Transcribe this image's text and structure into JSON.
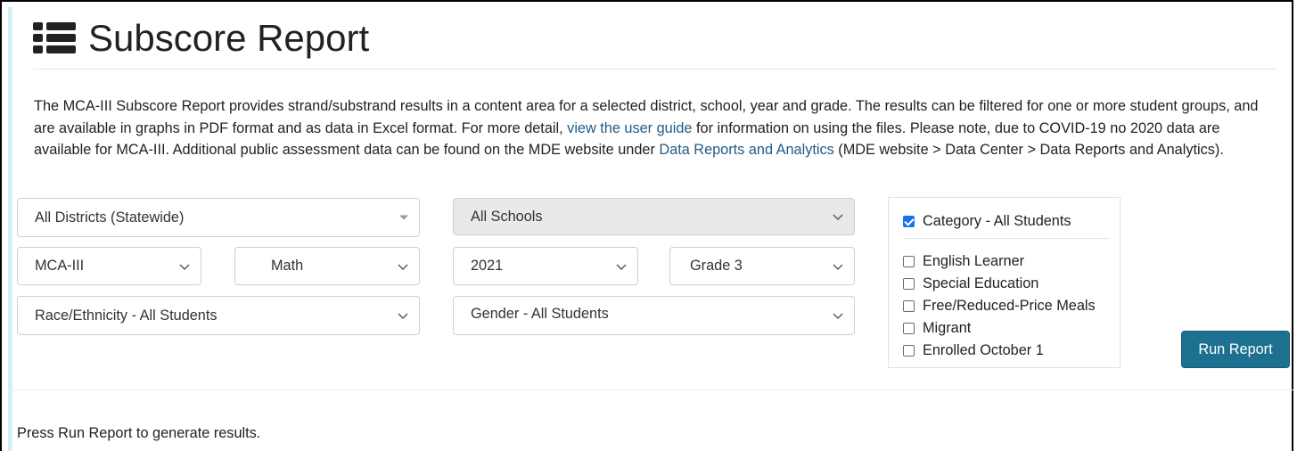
{
  "header": {
    "icon": "list-icon",
    "title": "Subscore Report"
  },
  "description": {
    "part1": "The MCA-III Subscore Report provides strand/substrand results in a content area for a selected district, school, year and grade. The results can be filtered for one or more student groups, and are available in graphs in PDF format and as data in Excel format. For more detail, ",
    "link_user_guide": "view the user guide",
    "part2": " for information on using the files. Please note, due to COVID-19 no 2020 data are available for MCA-III. Additional public assessment data can be found on the MDE website under ",
    "link_data_reports": "Data Reports and Analytics",
    "part3": " (MDE website > Data Center > Data Reports and Analytics)."
  },
  "filters": {
    "district": "All Districts (Statewide)",
    "school": "All Schools",
    "test": "MCA-III",
    "subject": "Math",
    "year": "2021",
    "grade": "Grade 3",
    "race_ethnicity": "Race/Ethnicity - All Students",
    "gender": "Gender - All Students"
  },
  "categories": {
    "all_students": {
      "label": "Category - All Students",
      "checked": true
    },
    "items": [
      {
        "label": "English Learner",
        "checked": false
      },
      {
        "label": "Special Education",
        "checked": false
      },
      {
        "label": "Free/Reduced-Price Meals",
        "checked": false
      },
      {
        "label": "Migrant",
        "checked": false
      },
      {
        "label": "Enrolled October 1",
        "checked": false
      }
    ]
  },
  "actions": {
    "run_report": "Run Report"
  },
  "status": {
    "message": "Press Run Report to generate results."
  },
  "colors": {
    "link": "#1f5c86",
    "button": "#1c7191",
    "checkbox_checked": "#1a73e8"
  }
}
